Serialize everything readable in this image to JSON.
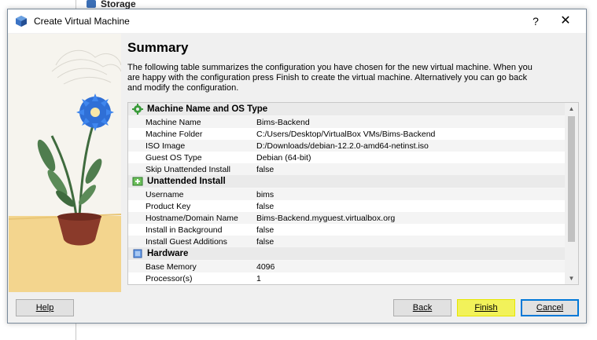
{
  "background": {
    "storage_label": "Storage"
  },
  "window": {
    "title": "Create Virtual Machine",
    "help_glyph": "?",
    "close_glyph": "✕"
  },
  "summary": {
    "heading": "Summary",
    "description": "The following table summarizes the configuration you have chosen for the new virtual machine. When you are happy with the configuration press Finish to create the virtual machine. Alternatively you can go back and modify the configuration."
  },
  "sections": [
    {
      "title": "Machine Name and OS Type",
      "icon": "gear-icon",
      "rows": [
        {
          "key": "Machine Name",
          "value": "Bims-Backend"
        },
        {
          "key": "Machine Folder",
          "value": "C:/Users/Desktop/VirtualBox VMs/Bims-Backend"
        },
        {
          "key": "ISO Image",
          "value": "D:/Downloads/debian-12.2.0-amd64-netinst.iso"
        },
        {
          "key": "Guest OS Type",
          "value": "Debian (64-bit)"
        },
        {
          "key": "Skip Unattended Install",
          "value": "false"
        }
      ]
    },
    {
      "title": "Unattended Install",
      "icon": "unattended-install-icon",
      "rows": [
        {
          "key": "Username",
          "value": "bims"
        },
        {
          "key": "Product Key",
          "value": "false"
        },
        {
          "key": "Hostname/Domain Name",
          "value": "Bims-Backend.myguest.virtualbox.org"
        },
        {
          "key": "Install in Background",
          "value": "false"
        },
        {
          "key": "Install Guest Additions",
          "value": "false"
        }
      ]
    },
    {
      "title": "Hardware",
      "icon": "chip-icon",
      "rows": [
        {
          "key": "Base Memory",
          "value": "4096"
        },
        {
          "key": "Processor(s)",
          "value": "1"
        }
      ]
    }
  ],
  "buttons": {
    "help": "Help",
    "back": "Back",
    "finish": "Finish",
    "cancel": "Cancel"
  },
  "colors": {
    "finish_highlight": "#f2f25a",
    "default_button_border": "#0078d7"
  }
}
